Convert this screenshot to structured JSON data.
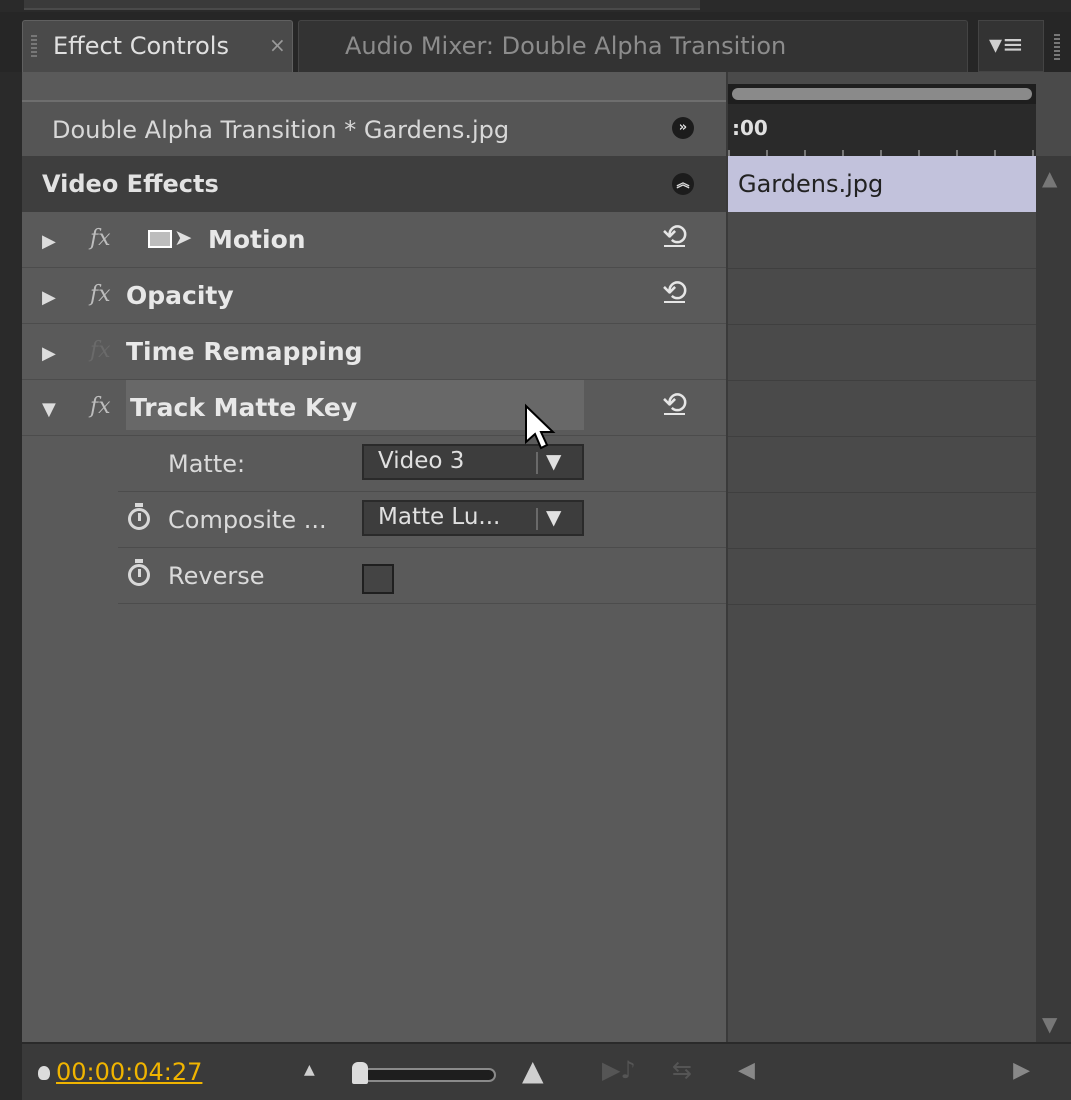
{
  "tabs": {
    "active_label": "Effect Controls",
    "active_close": "×",
    "inactive_label": "Audio Mixer: Double Alpha Transition",
    "menu_icon": "panel-menu-icon"
  },
  "clip_header": {
    "label": "Double Alpha Transition * Gardens.jpg",
    "toggle_icon": "show-timeline-icon"
  },
  "video_effects": {
    "label": "Video Effects",
    "collapse_icon": "collapse-icon"
  },
  "effects": [
    {
      "label": "Motion",
      "fx": "fx",
      "expanded": false,
      "has_reset": true
    },
    {
      "label": "Opacity",
      "fx": "fx",
      "expanded": false,
      "has_reset": true
    },
    {
      "label": "Time Remapping",
      "fx": "fx",
      "expanded": false,
      "has_reset": false
    },
    {
      "label": "Track Matte Key",
      "fx": "fx",
      "expanded": true,
      "has_reset": true
    }
  ],
  "track_matte_props": {
    "matte_label": "Matte:",
    "matte_value": "Video 3",
    "composite_label": "Composite ...",
    "composite_value": "Matte Lu...",
    "reverse_label": "Reverse",
    "reverse_checked": false
  },
  "timeline": {
    "ruler_time": ":00",
    "clip_label": "Gardens.jpg",
    "clip_color": "#c2c2dc"
  },
  "bottom": {
    "timecode": "00:00:04:27",
    "timecode_color": "#f0b400"
  }
}
